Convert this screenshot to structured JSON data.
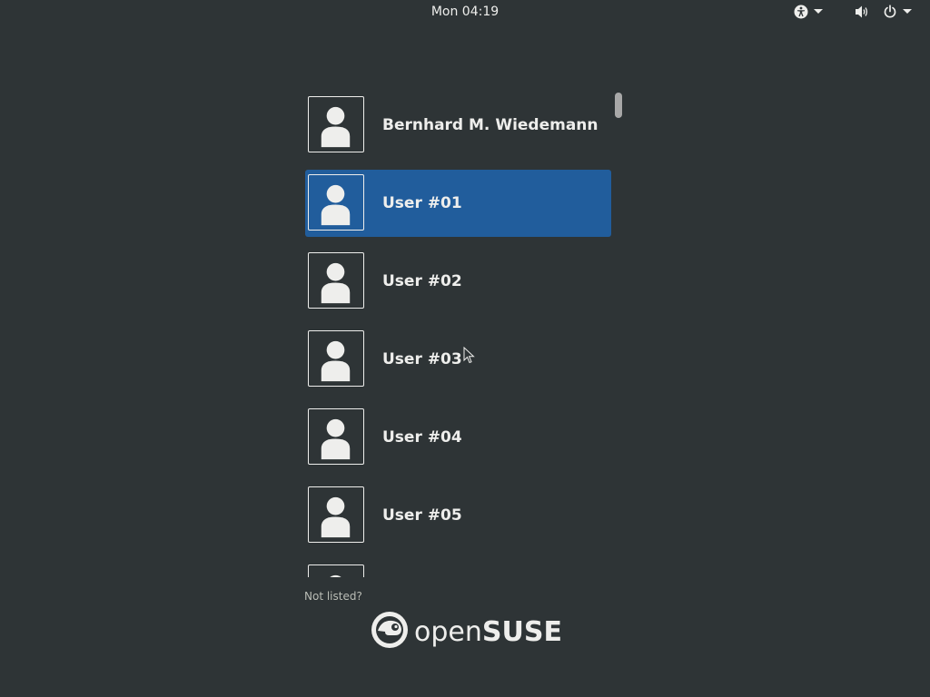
{
  "topbar": {
    "clock": "Mon 04:19",
    "icons": [
      "accessibility-icon",
      "volume-icon",
      "power-icon"
    ]
  },
  "users": [
    {
      "name": "Bernhard M. Wiedemann",
      "selected": false
    },
    {
      "name": "User #01",
      "selected": true
    },
    {
      "name": "User #02",
      "selected": false
    },
    {
      "name": "User #03",
      "selected": false
    },
    {
      "name": "User #04",
      "selected": false
    },
    {
      "name": "User #05",
      "selected": false
    }
  ],
  "not_listed": "Not listed?",
  "logo": {
    "prefix": "open",
    "suffix": "SUSE"
  },
  "colors": {
    "background": "#2e3436",
    "selection": "#215d9c",
    "text": "#eeeeec"
  }
}
